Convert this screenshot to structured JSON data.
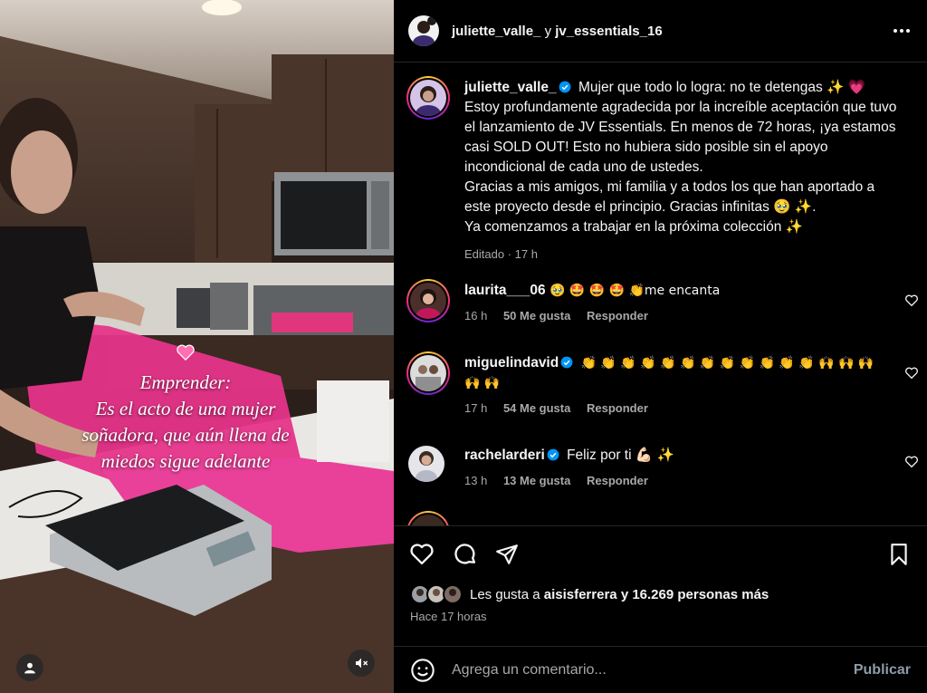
{
  "media": {
    "overlay_lines": [
      "Emprender:",
      "Es el acto de una mujer",
      "soñadora, que aún llena de",
      "miedos sigue adelante"
    ]
  },
  "header": {
    "user1": "juliette_valle_",
    "conj": "y",
    "user2": "jv_essentials_16"
  },
  "caption": {
    "username": "juliette_valle_",
    "text": "Mujer que todo lo logra: no te detengas ✨ 💗 Estoy profundamente agradecida por la increíble aceptación que tuvo el lanzamiento de JV Essentials. En menos de 72 horas, ¡ya estamos casi SOLD OUT! Esto no hubiera sido posible sin el apoyo incondicional de cada uno de ustedes.",
    "text2": "Gracias a mis amigos, mi familia y a todos los que han aportado a este proyecto desde el principio. Gracias infinitas 🥹 ✨.",
    "text3": "Ya comenzamos a trabajar en la próxima colección ✨",
    "meta": "Editado · 17 h"
  },
  "comments": [
    {
      "username": "laurita___06",
      "text": "🥹 🤩 🤩 🤩 👏me encanta",
      "time": "16 h",
      "likes": "50 Me gusta",
      "reply": "Responder"
    },
    {
      "username": "miguelindavid",
      "text": "👏 👏 👏 👏 👏 👏 👏 👏 👏 👏 👏 👏 🙌 🙌 🙌 🙌 🙌",
      "time": "17 h",
      "likes": "54 Me gusta",
      "reply": "Responder"
    },
    {
      "username": "rachelarderi",
      "text": "Feliz por ti 💪🏻 ✨",
      "time": "13 h",
      "likes": "13 Me gusta",
      "reply": "Responder"
    }
  ],
  "likes": {
    "prefix": "Les gusta a",
    "user": "aisisferrera",
    "suffix": "y 16.269 personas más"
  },
  "time_ago": "Hace 17 horas",
  "comment_input": {
    "placeholder": "Agrega un comentario..."
  },
  "post_label": "Publicar",
  "colors": {
    "verified": "#0095f6",
    "background": "#000000",
    "secondary_text": "#a8a8a8",
    "post_button": "#8e9ca8"
  }
}
